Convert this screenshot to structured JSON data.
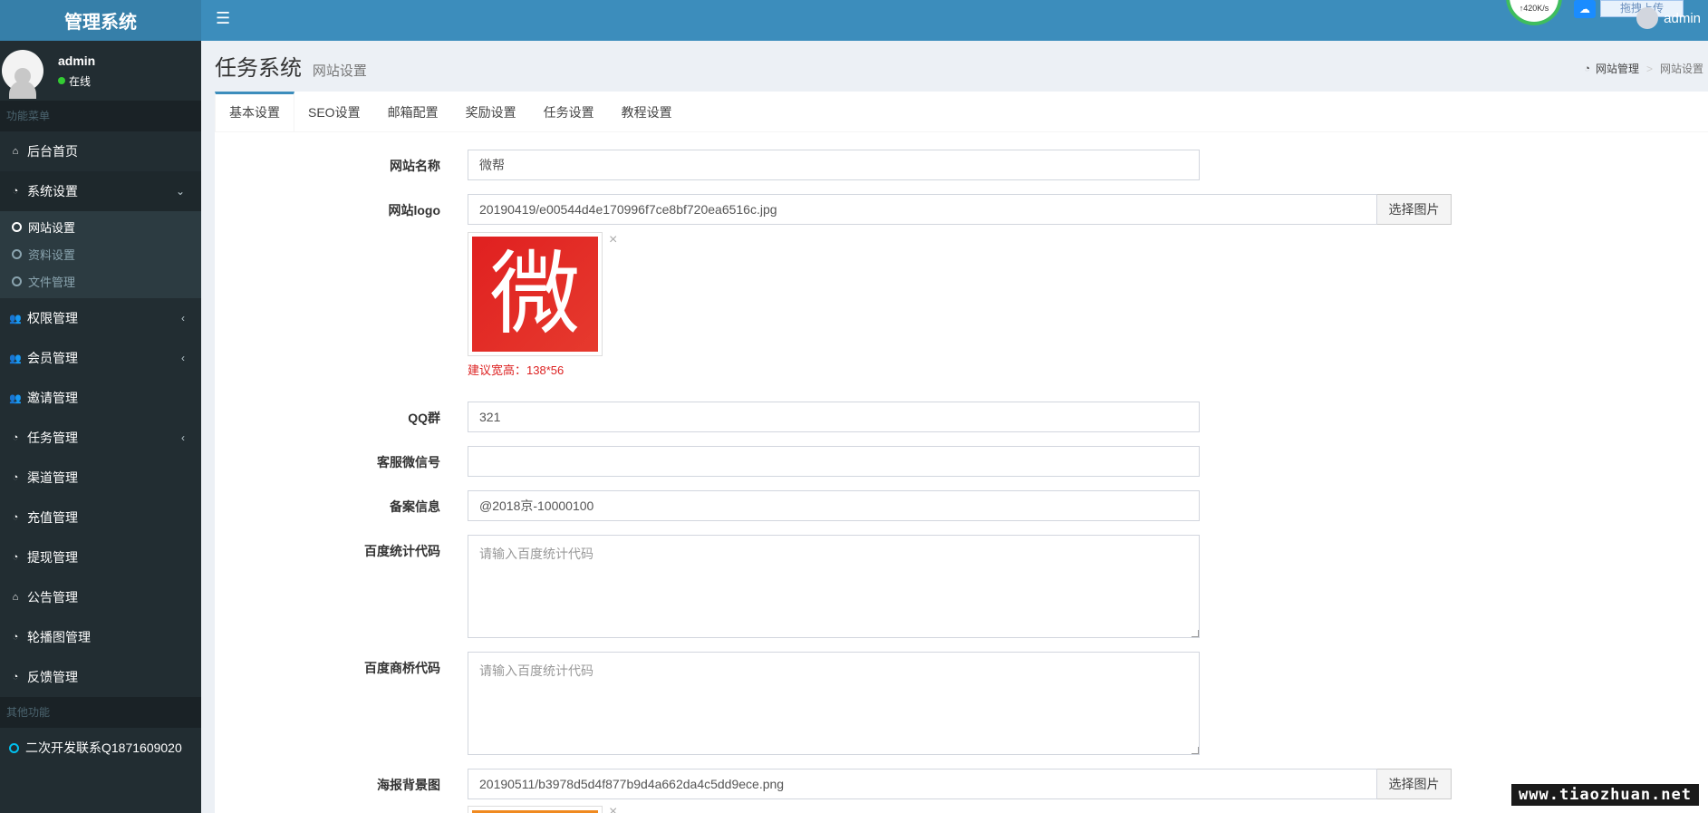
{
  "app": {
    "title": "管理系统"
  },
  "topbar": {
    "speed": "↑420K/s",
    "upload_label": "拖拽上传",
    "user": "admin"
  },
  "user_panel": {
    "name": "admin",
    "status": "在线"
  },
  "sidebar": {
    "header_main": "功能菜单",
    "items": [
      {
        "label": "后台首页",
        "icon": "home-icon"
      },
      {
        "label": "系统设置",
        "icon": "dashboard-icon"
      },
      {
        "label": "权限管理",
        "icon": "users-icon"
      },
      {
        "label": "会员管理",
        "icon": "users-icon"
      },
      {
        "label": "邀请管理",
        "icon": "users-icon"
      },
      {
        "label": "任务管理",
        "icon": "dashboard-icon"
      },
      {
        "label": "渠道管理",
        "icon": "dashboard-icon"
      },
      {
        "label": "充值管理",
        "icon": "dashboard-icon"
      },
      {
        "label": "提现管理",
        "icon": "dashboard-icon"
      },
      {
        "label": "公告管理",
        "icon": "home-icon"
      },
      {
        "label": "轮播图管理",
        "icon": "dashboard-icon"
      },
      {
        "label": "反馈管理",
        "icon": "dashboard-icon"
      }
    ],
    "sub_items": [
      {
        "label": "网站设置"
      },
      {
        "label": "资料设置"
      },
      {
        "label": "文件管理"
      }
    ],
    "header_other": "其他功能",
    "extra": "二次开发联系Q1871609020"
  },
  "page": {
    "title": "任务系统",
    "subtitle": "网站设置",
    "breadcrumb": {
      "root": "网站管理",
      "current": "网站设置"
    }
  },
  "tabs": [
    "基本设置",
    "SEO设置",
    "邮箱配置",
    "奖励设置",
    "任务设置",
    "教程设置"
  ],
  "form": {
    "site_name": {
      "label": "网站名称",
      "value": "微帮"
    },
    "site_logo": {
      "label": "网站logo",
      "value": "20190419/e00544d4e170996f7ce8bf720ea6516c.jpg",
      "button": "选择图片",
      "preview_char": "微",
      "hint": "建议宽高：138*56"
    },
    "qq_group": {
      "label": "QQ群",
      "value": "321"
    },
    "service_wechat": {
      "label": "客服微信号",
      "value": ""
    },
    "icp": {
      "label": "备案信息",
      "value": "@2018京-10000100"
    },
    "baidu_stats": {
      "label": "百度统计代码",
      "placeholder": "请输入百度统计代码"
    },
    "baidu_bridge": {
      "label": "百度商桥代码",
      "placeholder": "请输入百度统计代码"
    },
    "poster_bg": {
      "label": "海报背景图",
      "value": "20190511/b3978d5d4f877b9d4a662da4c5dd9ece.png",
      "button": "选择图片"
    }
  },
  "watermark": "www.tiaozhuan.net",
  "colors": {
    "header": "#3c8dbc",
    "logo_bg": "#367fa9",
    "sidebar": "#222d32",
    "accent_red": "#dd2222"
  }
}
